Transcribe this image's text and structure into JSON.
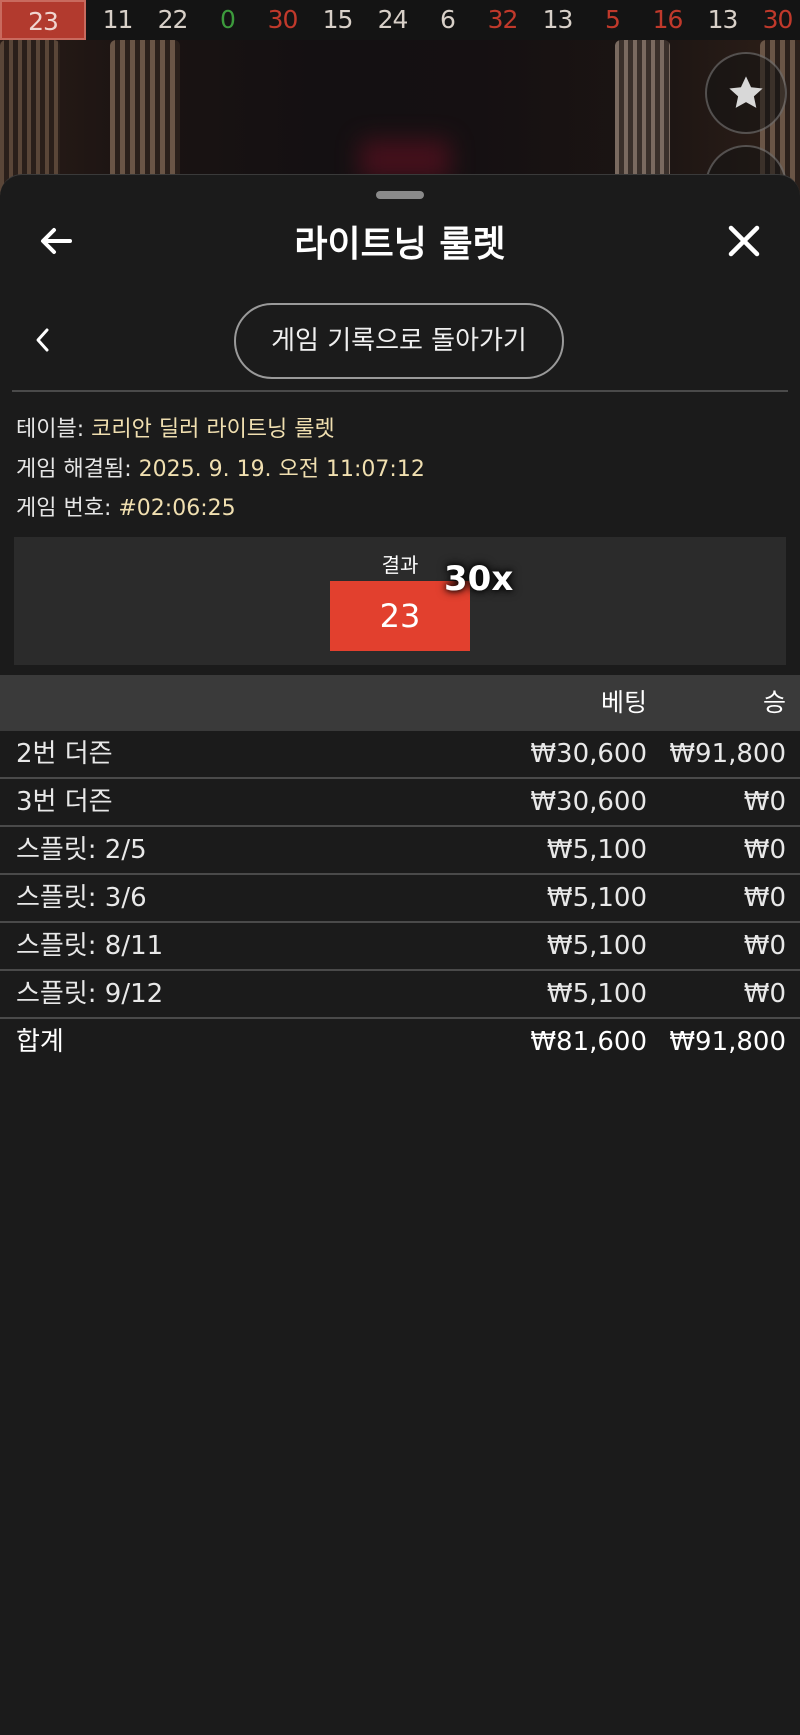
{
  "history": [
    {
      "value": "23",
      "color": "#f0d5d0",
      "current": true
    },
    {
      "value": "11",
      "color": "#d8d0c8"
    },
    {
      "value": "22",
      "color": "#d8d0c8"
    },
    {
      "value": "0",
      "color": "#3c9a3c"
    },
    {
      "value": "30",
      "color": "#c0392b"
    },
    {
      "value": "15",
      "color": "#d8d0c8"
    },
    {
      "value": "24",
      "color": "#d8d0c8"
    },
    {
      "value": "6",
      "color": "#d8d0c8"
    },
    {
      "value": "32",
      "color": "#c0392b"
    },
    {
      "value": "13",
      "color": "#d8d0c8"
    },
    {
      "value": "5",
      "color": "#c0392b"
    },
    {
      "value": "16",
      "color": "#c0392b"
    },
    {
      "value": "13",
      "color": "#d8d0c8"
    },
    {
      "value": "30",
      "color": "#c0392b"
    }
  ],
  "sheet": {
    "title": "라이트닝 룰렛",
    "back_to_history": "게임 기록으로 돌아가기"
  },
  "info": {
    "table_label": "테이블:",
    "table_value": "코리안 딜러 라이트닝 룰렛",
    "resolved_label": "게임 해결됨:",
    "resolved_value": "2025. 9. 19. 오전 11:07:12",
    "number_label": "게임 번호:",
    "number_value": "#02:06:25"
  },
  "result": {
    "label": "결과",
    "number": "23",
    "multiplier": "30x",
    "color": "#e2402e"
  },
  "bets": {
    "headers": [
      "",
      "베팅",
      "승"
    ],
    "rows": [
      [
        "2번 더즌",
        "₩30,600",
        "₩91,800"
      ],
      [
        "3번 더즌",
        "₩30,600",
        "₩0"
      ],
      [
        "스플릿: 2/5",
        "₩5,100",
        "₩0"
      ],
      [
        "스플릿: 3/6",
        "₩5,100",
        "₩0"
      ],
      [
        "스플릿: 8/11",
        "₩5,100",
        "₩0"
      ],
      [
        "스플릿: 9/12",
        "₩5,100",
        "₩0"
      ]
    ],
    "total": [
      "합계",
      "₩81,600",
      "₩91,800"
    ]
  },
  "icons": [
    "star-icon",
    "more-icon",
    "back-arrow-icon",
    "close-icon",
    "chevron-left-icon"
  ]
}
